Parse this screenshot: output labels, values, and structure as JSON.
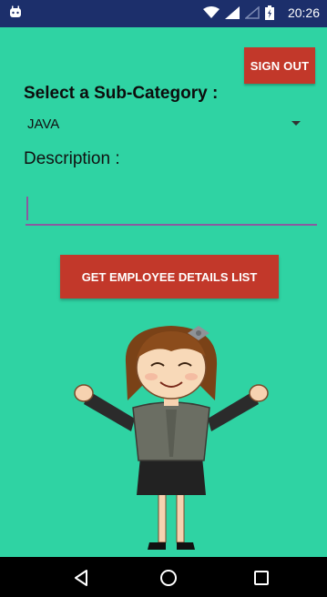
{
  "status_bar": {
    "time": "20:26"
  },
  "header": {
    "sign_out_label": "SIGN OUT"
  },
  "form": {
    "select_label": "Select a Sub-Category :",
    "subcategory_value": "JAVA",
    "description_label": "Description :",
    "description_value": ""
  },
  "actions": {
    "get_list_label": "GET EMPLOYEE DETAILS LIST"
  },
  "illustration": {
    "type": "cartoon-woman-arms-open-icon"
  },
  "colors": {
    "background": "#2fd3a3",
    "status_bar": "#1c2f6b",
    "button": "#c2382a",
    "input_underline": "#8a5aa0",
    "nav_bar": "#000000"
  },
  "nav": {
    "icons": [
      "back-icon",
      "home-icon",
      "recents-icon"
    ]
  }
}
